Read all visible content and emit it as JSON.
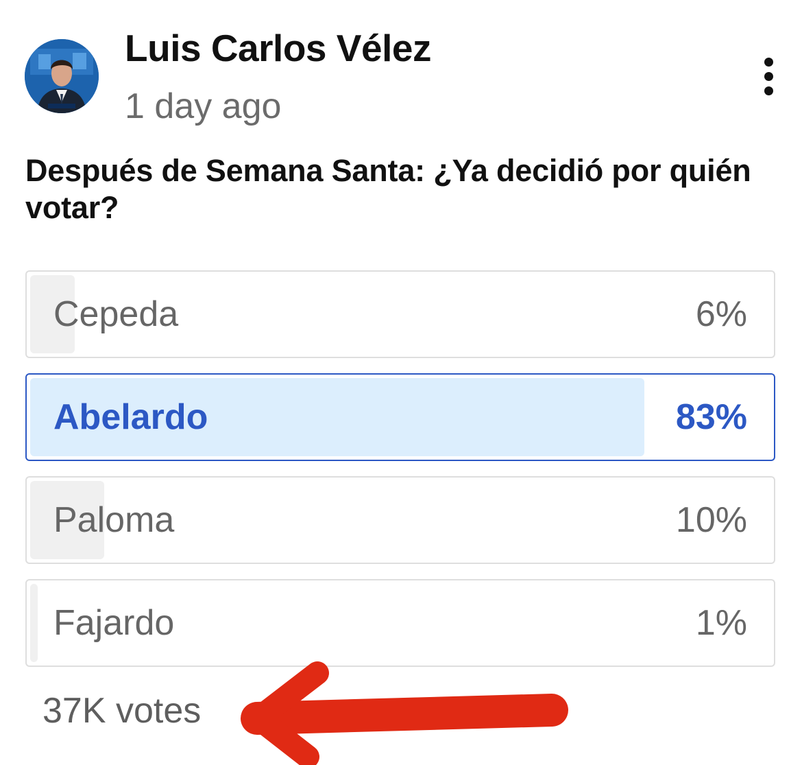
{
  "post": {
    "author": "Luis Carlos Vélez",
    "time": "1 day ago",
    "avatar_icon": "profile-photo",
    "more_icon": "vertical-ellipsis-icon"
  },
  "poll": {
    "question": "Después de Semana Santa: ¿Ya decidió por quién votar?",
    "options": [
      {
        "label": "Cepeda",
        "percent": "6%",
        "value": 6,
        "selected": false
      },
      {
        "label": "Abelardo",
        "percent": "83%",
        "value": 83,
        "selected": true
      },
      {
        "label": "Paloma",
        "percent": "10%",
        "value": 10,
        "selected": false
      },
      {
        "label": "Fajardo",
        "percent": "1%",
        "value": 1,
        "selected": false
      }
    ],
    "votes": "37K votes"
  },
  "annotation": {
    "type": "hand-drawn-arrow",
    "color": "#e02a14",
    "points_to": "votes"
  },
  "colors": {
    "selected_accent": "#2c58c4",
    "selected_fill": "#dceefd",
    "unselected_fill": "#f0f0f0",
    "border": "#dedede"
  }
}
